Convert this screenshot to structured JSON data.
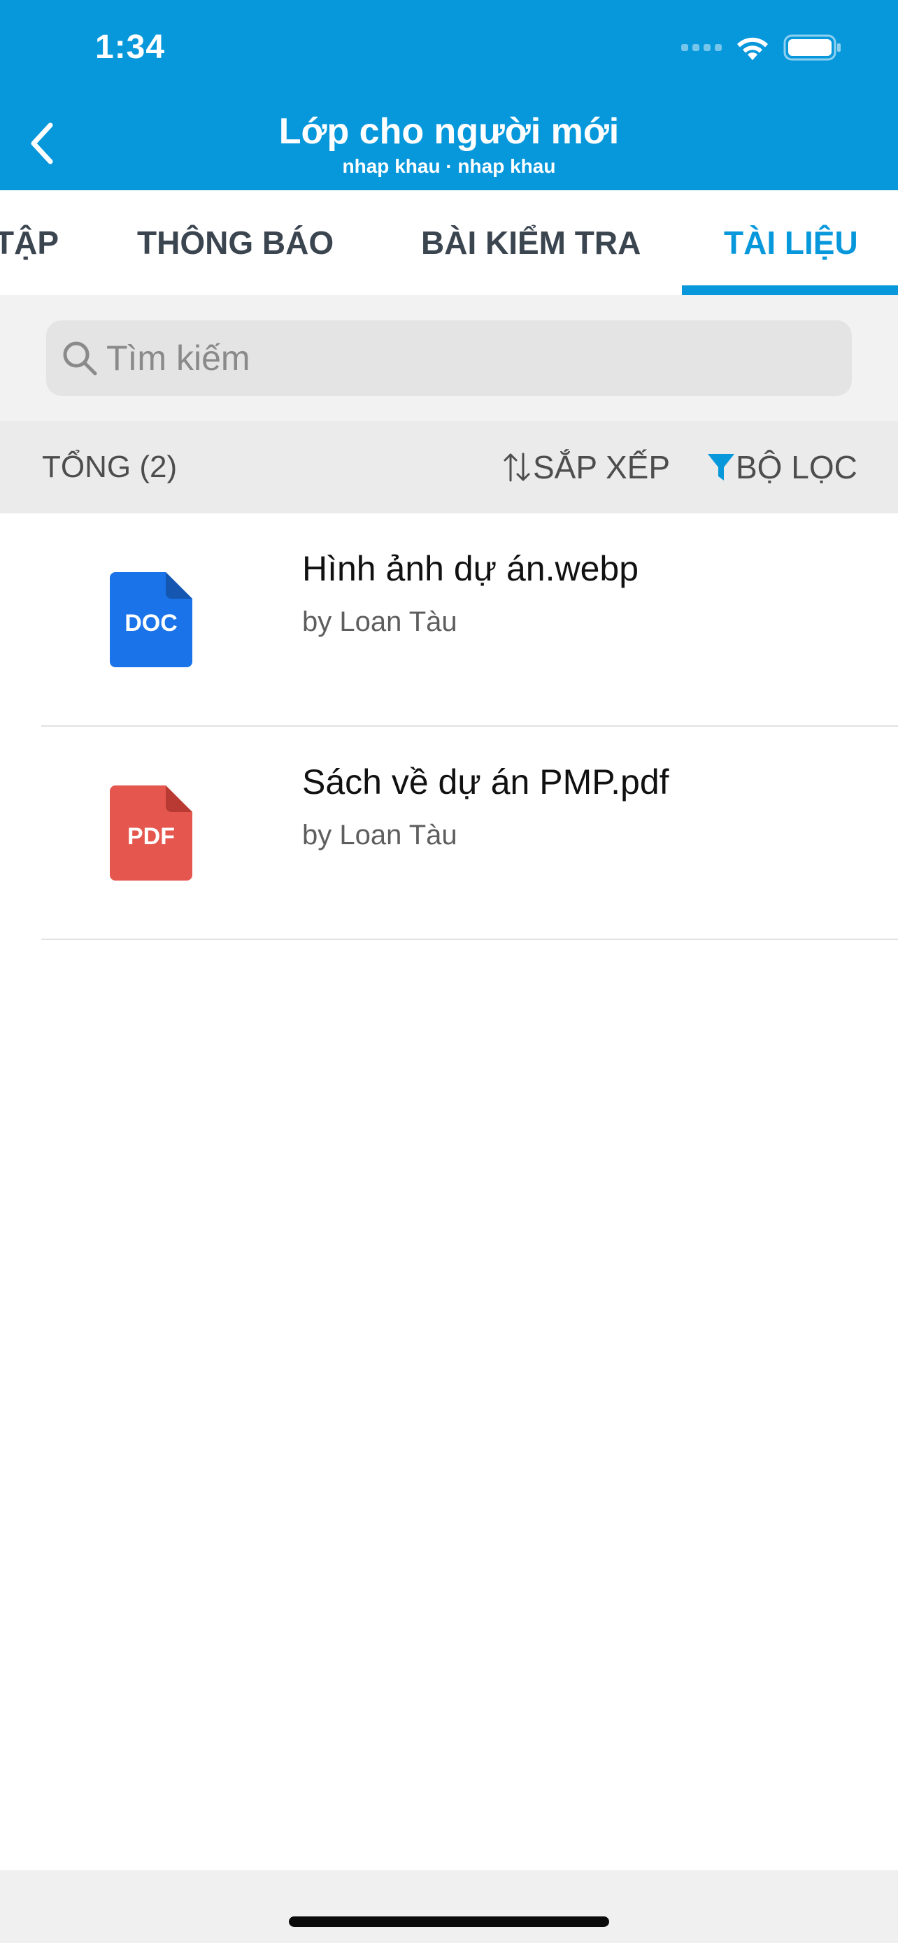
{
  "status_bar": {
    "time": "1:34"
  },
  "header": {
    "title": "Lớp cho người mới",
    "subtitle": "nhap khau · nhap khau",
    "background_color": "#0798dc"
  },
  "tabs": [
    {
      "label": "TẬP",
      "active": false
    },
    {
      "label": "THÔNG BÁO",
      "active": false
    },
    {
      "label": "BÀI KIỂM TRA",
      "active": false
    },
    {
      "label": "TÀI LIỆU",
      "active": true
    }
  ],
  "search": {
    "placeholder": "Tìm kiếm",
    "value": ""
  },
  "toolbar": {
    "total_label": "TỔNG (2)",
    "sort_label": "SẮP XẾP",
    "filter_label": "BỘ LỌC",
    "filter_icon_color": "#0798dc"
  },
  "files": [
    {
      "name": "Hình ảnh dự án.webp",
      "author": "by Loan Tàu",
      "type_label": "DOC",
      "icon": "doc-file-icon",
      "color": "#1a73e8"
    },
    {
      "name": "Sách về dự án PMP.pdf",
      "author": "by Loan Tàu",
      "type_label": "PDF",
      "icon": "pdf-file-icon",
      "color": "#e5574e"
    }
  ]
}
